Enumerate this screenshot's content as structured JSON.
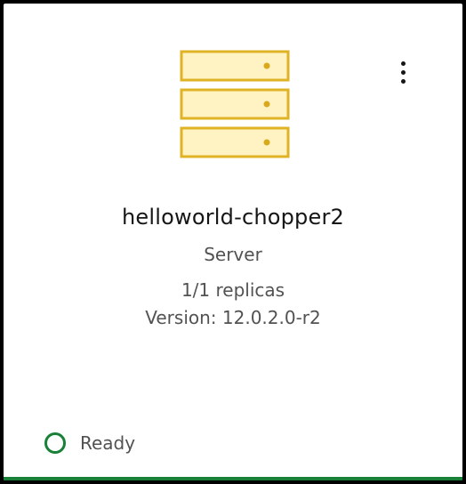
{
  "card": {
    "icon": "server-stack-icon",
    "menu_icon": "overflow-menu-vertical-icon",
    "title": "helloworld-chopper2",
    "type": "Server",
    "replicas": "1/1 replicas",
    "version": "Version: 12.0.2.0-r2",
    "status": {
      "icon": "status-ring-icon",
      "label": "Ready",
      "color": "#198038"
    }
  },
  "colors": {
    "icon_fill": "#fff3c4",
    "icon_stroke": "#e0b324",
    "status_green": "#198038",
    "text_primary": "#161616",
    "text_secondary": "#525252"
  }
}
